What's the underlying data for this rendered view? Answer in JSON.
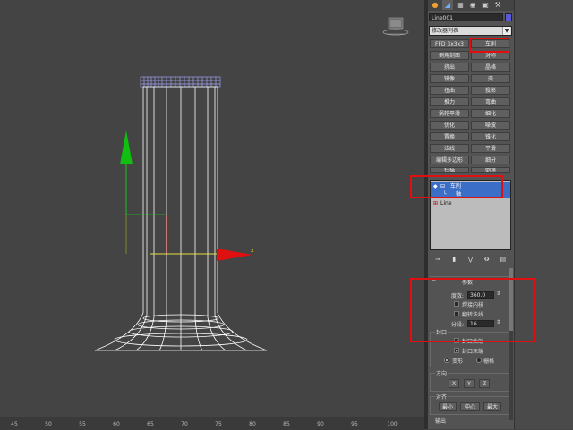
{
  "command_panel": {
    "tabs": [
      "create-tab",
      "modify-tab",
      "hierarchy-tab",
      "motion-tab",
      "display-tab",
      "utilities-tab"
    ],
    "object_name": "Line001",
    "object_color": "#5a5ad8",
    "modifier_list_label": "修改器列表",
    "modifier_buttons": [
      [
        "FFD 3x3x3",
        "车削"
      ],
      [
        "倒角剖面",
        "对称"
      ],
      [
        "挤出",
        "晶格"
      ],
      [
        "镜像",
        "壳"
      ],
      [
        "扭曲",
        "投影"
      ],
      [
        "推力",
        "弯曲"
      ],
      [
        "涡轮平滑",
        "细化"
      ],
      [
        "优化",
        "噪波"
      ],
      [
        "置换",
        "锥化"
      ],
      [
        "法线",
        "平滑"
      ],
      [
        "编辑多边形",
        "细分"
      ],
      [
        "扫描",
        "倒角"
      ]
    ],
    "stack": {
      "lathe": "车削",
      "axis": "轴",
      "base": "Line"
    }
  },
  "parameters": {
    "rollout_title": "参数",
    "degrees_label": "度数:",
    "degrees_value": "360.0",
    "weld_core": "焊接内核",
    "flip_normals": "翻转法线",
    "segments_label": "分段:",
    "segments_value": "16",
    "capping": {
      "title": "封口",
      "cap_start": "封口始端",
      "cap_end": "封口末端",
      "morph": "变形",
      "grid": "栅格"
    },
    "direction": {
      "title": "方向",
      "x": "X",
      "y": "Y",
      "z": "Z"
    },
    "align": {
      "title": "对齐",
      "min": "最小",
      "center": "中心",
      "max": "最大"
    },
    "output_title": "输出"
  },
  "ruler": {
    "labels": [
      "45",
      "50",
      "55",
      "60",
      "65",
      "70",
      "75",
      "80",
      "85",
      "90",
      "95",
      "100"
    ]
  },
  "gizmo": {
    "x_label": "x"
  }
}
